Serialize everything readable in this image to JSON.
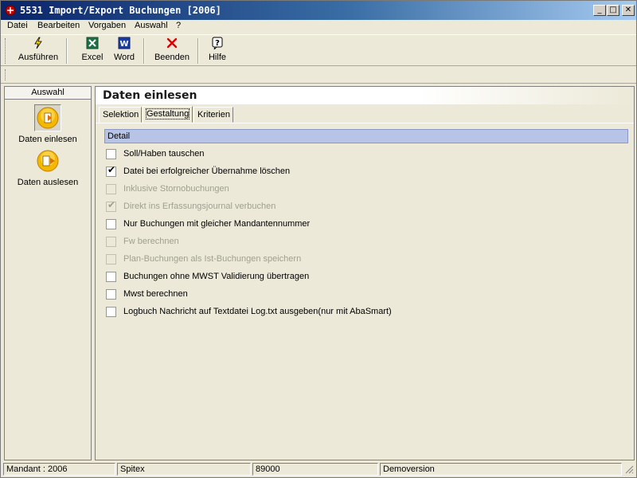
{
  "window": {
    "title": "5531 Import/Export Buchungen [2006]"
  },
  "menu": [
    {
      "label": "Datei"
    },
    {
      "label": "Bearbeiten"
    },
    {
      "label": "Vorgaben"
    },
    {
      "label": "Auswahl"
    },
    {
      "label": "?"
    }
  ],
  "toolbar": {
    "execute": "Ausführen",
    "excel": "Excel",
    "word": "Word",
    "quit": "Beenden",
    "help": "Hilfe"
  },
  "left": {
    "header": "Auswahl",
    "items": [
      {
        "label": "Daten einlesen",
        "icon": "import-arrow-icon",
        "active": true
      },
      {
        "label": "Daten auslesen",
        "icon": "export-arrow-icon",
        "active": false
      }
    ]
  },
  "main": {
    "title": "Daten einlesen",
    "tabs": [
      "Selektion",
      "Gestaltung",
      "Kriterien"
    ],
    "active_tab": "Gestaltung",
    "section": "Detail",
    "options": [
      {
        "label": "Soll/Haben tauschen",
        "checked": false,
        "enabled": true
      },
      {
        "label": "Datei bei erfolgreicher Übernahme löschen",
        "checked": true,
        "enabled": true
      },
      {
        "label": "Inklusive Stornobuchungen",
        "checked": false,
        "enabled": false
      },
      {
        "label": "Direkt ins Erfassungsjournal verbuchen",
        "checked": true,
        "enabled": false
      },
      {
        "label": "Nur Buchungen mit gleicher Mandantennummer",
        "checked": false,
        "enabled": true
      },
      {
        "label": "Fw berechnen",
        "checked": false,
        "enabled": false
      },
      {
        "label": "Plan-Buchungen als Ist-Buchungen speichern",
        "checked": false,
        "enabled": false
      },
      {
        "label": "Buchungen ohne MWST Validierung übertragen",
        "checked": false,
        "enabled": true
      },
      {
        "label": "Mwst berechnen",
        "checked": false,
        "enabled": true
      },
      {
        "label": "Logbuch Nachricht auf Textdatei Log.txt ausgeben(nur mit AbaSmart)",
        "checked": false,
        "enabled": true
      }
    ]
  },
  "status": {
    "mandant": "Mandant : 2006",
    "company": "Spitex",
    "number": "89000",
    "mode": "Demoversion"
  }
}
